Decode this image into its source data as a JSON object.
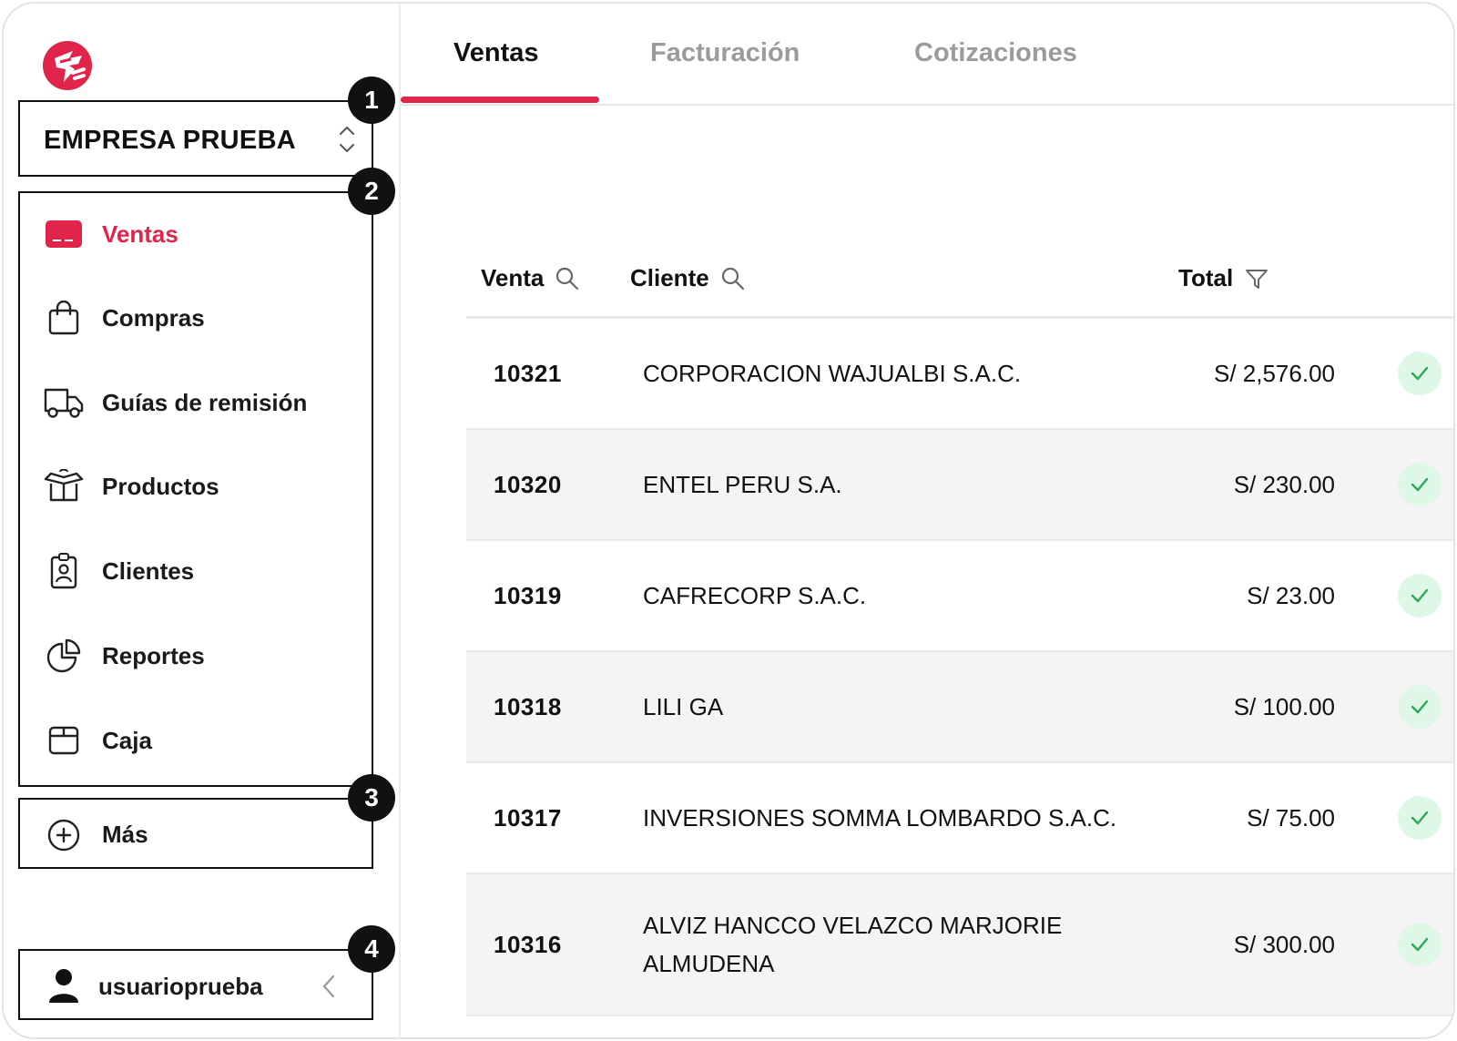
{
  "brand": {
    "accent": "#e0244a"
  },
  "company": {
    "name": "EMPRESA PRUEBA"
  },
  "nav": {
    "items": [
      {
        "label": "Ventas",
        "icon": "sales-card-icon",
        "active": true
      },
      {
        "label": "Compras",
        "icon": "shopping-bag-icon"
      },
      {
        "label": "Guías de remisión",
        "icon": "truck-icon"
      },
      {
        "label": "Productos",
        "icon": "product-box-icon"
      },
      {
        "label": "Clientes",
        "icon": "client-badge-icon"
      },
      {
        "label": "Reportes",
        "icon": "pie-chart-icon"
      },
      {
        "label": "Caja",
        "icon": "cash-box-icon"
      }
    ],
    "more": {
      "label": "Más"
    }
  },
  "user": {
    "name": "usuarioprueba"
  },
  "badges": [
    "1",
    "2",
    "3",
    "4"
  ],
  "tabs": [
    {
      "label": "Ventas",
      "active": true
    },
    {
      "label": "Facturación"
    },
    {
      "label": "Cotizaciones"
    }
  ],
  "table": {
    "columns": {
      "venta": "Venta",
      "cliente": "Cliente",
      "total": "Total"
    },
    "rows": [
      {
        "id": "10321",
        "client": "CORPORACION WAJUALBI S.A.C.",
        "total": "S/ 2,576.00"
      },
      {
        "id": "10320",
        "client": "ENTEL PERU S.A.",
        "total": "S/ 230.00"
      },
      {
        "id": "10319",
        "client": "CAFRECORP S.A.C.",
        "total": "S/ 23.00"
      },
      {
        "id": "10318",
        "client": "LILI GA",
        "total": "S/ 100.00"
      },
      {
        "id": "10317",
        "client": "INVERSIONES SOMMA LOMBARDO S.A.C.",
        "total": "S/ 75.00"
      },
      {
        "id": "10316",
        "client": "ALVIZ HANCCO VELAZCO MARJORIE ALMUDENA",
        "total": "S/ 300.00"
      }
    ]
  }
}
